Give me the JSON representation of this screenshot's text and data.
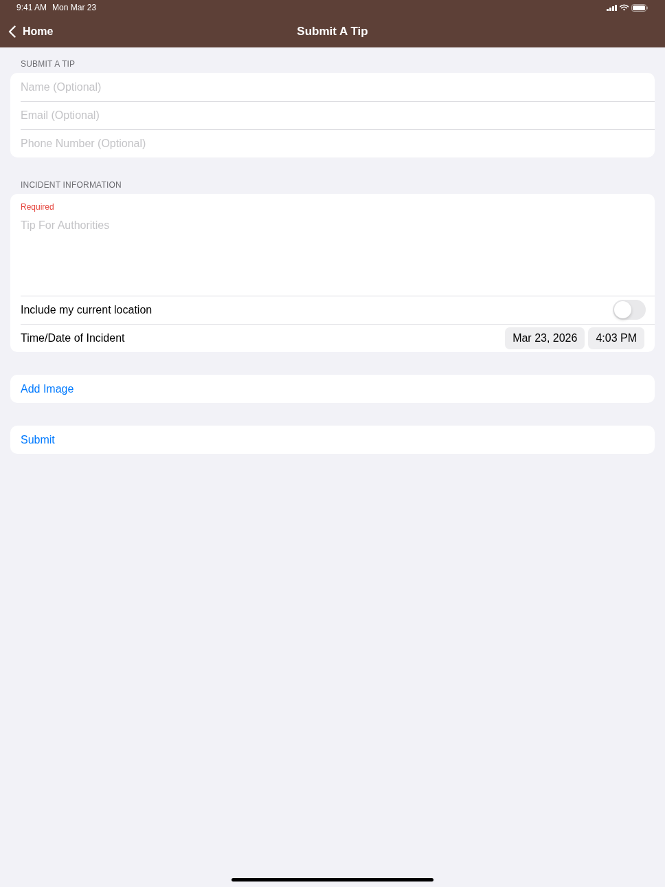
{
  "status_bar": {
    "time": "9:41 AM",
    "date": "Mon Mar 23"
  },
  "nav_bar": {
    "back_label": "Home",
    "title": "Submit A Tip"
  },
  "sections": [
    {
      "header": "SUBMIT A TIP",
      "rows": [
        {
          "kind": "text_field",
          "placeholder": "Name (Optional)"
        },
        {
          "kind": "text_field",
          "placeholder": "Email (Optional)"
        },
        {
          "kind": "text_field",
          "placeholder": "Phone Number (Optional)"
        }
      ]
    },
    {
      "header": "INCIDENT INFORMATION",
      "rows": [
        {
          "kind": "text_area",
          "note": "Required",
          "placeholder": "Tip For Authorities"
        },
        {
          "kind": "toggle",
          "label": "Include my current location",
          "on": false
        },
        {
          "kind": "date_time",
          "label": "Time/Date of Incident",
          "date": "Mar 23, 2026",
          "time": "4:03 PM"
        }
      ]
    },
    {
      "rows": [
        {
          "kind": "action",
          "label": "Add Image"
        }
      ]
    },
    {
      "rows": [
        {
          "kind": "action",
          "label": "Submit"
        }
      ]
    }
  ]
}
